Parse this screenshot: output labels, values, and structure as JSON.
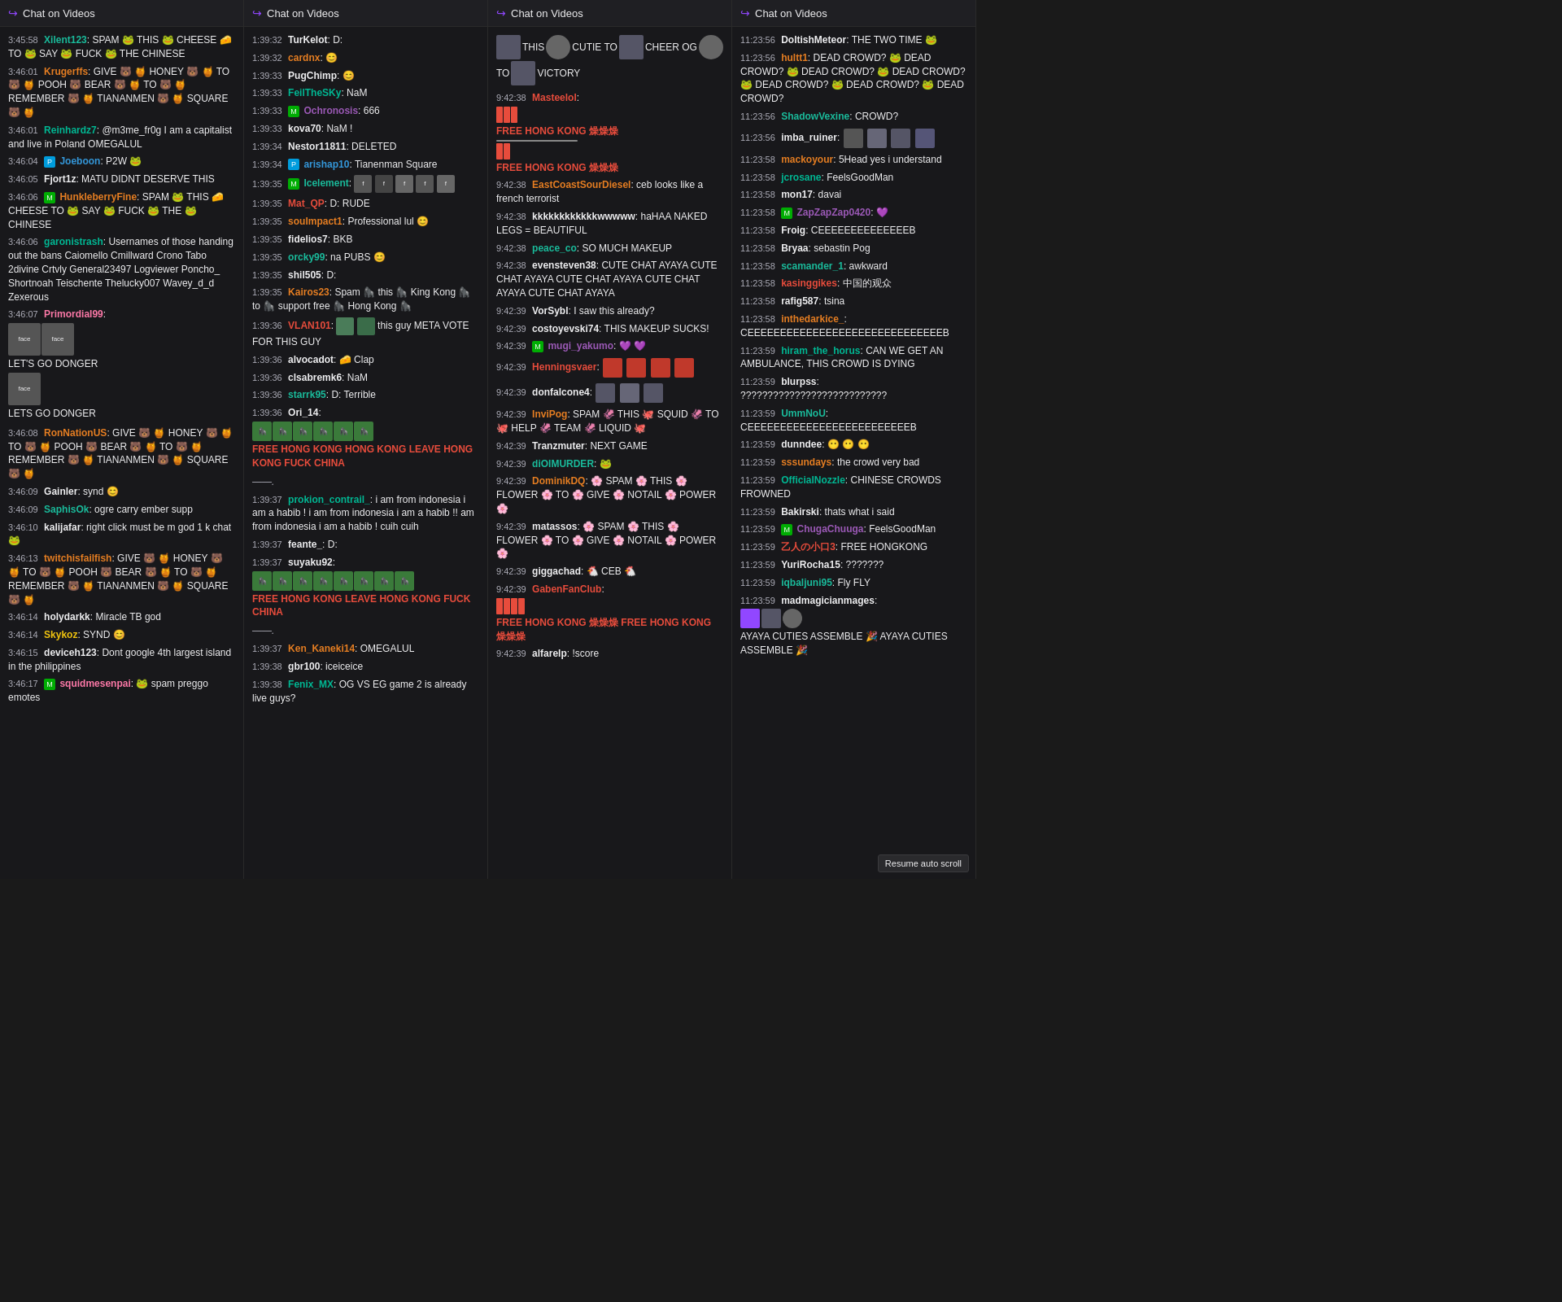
{
  "panels": [
    {
      "id": "panel1",
      "header": "Chat on Videos",
      "messages": [
        {
          "ts": "3:45:58",
          "user": "Xilent123",
          "userColor": "col-cyan",
          "text": "SPAM 🐸 THIS 🐸 CHEESE 🧀 TO 🐸 SAY 🐸 FUCK 🐸 THE CHINESE"
        },
        {
          "ts": "3:46:01",
          "user": "Krugerffs",
          "userColor": "col-orange",
          "text": "GIVE 🐻 🍯 HONEY 🐻 🍯 TO 🐻 🍯 POOH 🐻 BEAR 🐻 🍯 TO 🐻 🍯 REMEMBER 🐻 🍯 TIANANMEN 🐻 🍯 SQUARE 🐻 🍯"
        },
        {
          "ts": "3:46:01",
          "user": "Reinhardz7",
          "userColor": "col-green",
          "text": "@m3me_fr0g I am a capitalist and live in Poland OMEGALUL"
        },
        {
          "ts": "3:46:04",
          "user": "Joeboon",
          "userColor": "col-blue",
          "badge": "prime",
          "text": "P2W 🐸"
        },
        {
          "ts": "3:46:05",
          "user": "Fjort1z",
          "userColor": "col-white",
          "text": "MATU DIDNT DESERVE THIS"
        },
        {
          "ts": "3:46:06",
          "user": "HunkleberryFine",
          "userColor": "col-orange",
          "badge": "mod",
          "text": "SPAM 🐸 THIS 🧀 CHEESE TO 🐸 SAY 🐸 FUCK 🐸 THE 🐸 CHINESE"
        },
        {
          "ts": "3:46:06",
          "user": "garonistrash",
          "userColor": "col-green",
          "text": "Usernames of those handing out the bans Caiomello Cmillward Crono Tabo 2divine Crtvly General23497 Logviewer Poncho_ Shortnoah Teischente Thelucky007 Wavey_d_d Zexerous"
        },
        {
          "ts": "3:46:07",
          "user": "PrimordiaI99",
          "userColor": "col-pink",
          "text": "[emote block] LET'S GO DONGER LETS GO DONGER"
        },
        {
          "ts": "3:46:08",
          "user": "RonNationUS",
          "userColor": "col-orange",
          "text": "GIVE 🐻 🍯 HONEY 🐻 🍯 TO 🐻 🍯 POOH 🐻 BEAR 🐻 🍯 TO 🐻 🍯 REMEMBER 🐻 🍯 TIANANMEN 🐻 🍯 SQUARE 🐻 🍯"
        },
        {
          "ts": "3:46:09",
          "user": "Gainler",
          "userColor": "col-white",
          "text": "synd 😊"
        },
        {
          "ts": "3:46:09",
          "user": "SaphisOk",
          "userColor": "col-cyan",
          "text": "ogre carry ember supp"
        },
        {
          "ts": "3:46:10",
          "user": "kalijafar",
          "userColor": "col-white",
          "text": "right click must be m god 1 k chat 🐸"
        },
        {
          "ts": "3:46:13",
          "user": "twitchisfailfish",
          "userColor": "col-orange",
          "text": "GIVE 🐻 🍯 HONEY 🐻 🍯 TO 🐻 🍯 POOH 🐻 BEAR 🐻 🍯 TO 🐻 🍯 REMEMBER 🐻 🍯 TIANANMEN 🐻 🍯 SQUARE 🐻 🍯"
        },
        {
          "ts": "3:46:14",
          "user": "holydarkk",
          "userColor": "col-white",
          "text": "Miracle TB god"
        },
        {
          "ts": "3:46:14",
          "user": "Skykoz",
          "userColor": "col-yellow",
          "text": "SYND 😊"
        },
        {
          "ts": "3:46:15",
          "user": "deviceh123",
          "userColor": "col-white",
          "text": "Dont google 4th largest island in the philippines"
        },
        {
          "ts": "3:46:17",
          "user": "squidmesenpai",
          "userColor": "col-pink",
          "badge": "mod",
          "text": "🐸 spam preggo emotes"
        }
      ]
    },
    {
      "id": "panel2",
      "header": "Chat on Videos",
      "messages": [
        {
          "ts": "1:39:32",
          "user": "TurKelot",
          "userColor": "col-white",
          "text": "D:"
        },
        {
          "ts": "1:39:32",
          "user": "cardnx",
          "userColor": "col-orange",
          "text": "😊"
        },
        {
          "ts": "1:39:33",
          "user": "PugChimp",
          "userColor": "col-white",
          "text": "😊"
        },
        {
          "ts": "1:39:33",
          "user": "FeilTheSKy",
          "userColor": "col-green",
          "text": "NaM"
        },
        {
          "ts": "1:39:33",
          "user": "Ochronosis",
          "userColor": "col-purple",
          "badge": "mod",
          "text": "666"
        },
        {
          "ts": "1:39:33",
          "user": "kova70",
          "userColor": "col-white",
          "text": "NaM !"
        },
        {
          "ts": "1:39:34",
          "user": "Nestor11811",
          "userColor": "col-white",
          "text": "DELETED"
        },
        {
          "ts": "1:39:34",
          "user": "arishap10",
          "userColor": "col-blue",
          "badge": "prime",
          "text": "Tianenman Square"
        },
        {
          "ts": "1:39:35",
          "user": "Icelement",
          "userColor": "col-cyan",
          "badge": "mod",
          "text": "[face emotes row]"
        },
        {
          "ts": "1:39:35",
          "user": "Mat_QP",
          "userColor": "col-red",
          "text": "D: RUDE"
        },
        {
          "ts": "1:39:35",
          "user": "soulmpact1",
          "userColor": "col-orange",
          "text": "Professional lul 😊"
        },
        {
          "ts": "1:39:35",
          "user": "fidelios7",
          "userColor": "col-white",
          "text": "BKB"
        },
        {
          "ts": "1:39:35",
          "user": "orcky99",
          "userColor": "col-cyan",
          "text": "na PUBS 😊"
        },
        {
          "ts": "1:39:35",
          "user": "shil505",
          "userColor": "col-white",
          "text": "D:"
        },
        {
          "ts": "1:39:35",
          "user": "Kairos23",
          "userColor": "col-orange",
          "text": "Spam 🦍 this 🦍 King Kong 🦍 to 🦍 support free 🦍 Hong Kong 🦍"
        },
        {
          "ts": "1:39:36",
          "user": "VLAN101",
          "userColor": "col-red",
          "text": "[emotes] this guy META VOTE FOR THIS GUY"
        },
        {
          "ts": "1:39:36",
          "user": "alvocadot",
          "userColor": "col-white",
          "text": "🧀 Clap"
        },
        {
          "ts": "1:39:36",
          "user": "clsabremk6",
          "userColor": "col-white",
          "text": "NaM"
        },
        {
          "ts": "1:39:36",
          "user": "starrk95",
          "userColor": "col-cyan",
          "text": "D: Terrible"
        },
        {
          "ts": "1:39:36",
          "user": "Ori_14",
          "userColor": "col-white",
          "text": "[emote grid] FREE HONG KONG HONG KONG LEAVE HONG KONG FUCK CHINA"
        },
        {
          "ts": "",
          "user": "",
          "userColor": "",
          "text": ""
        },
        {
          "ts": "1:39:37",
          "user": "prokion_contrail_",
          "userColor": "col-green",
          "text": "i am from indonesia i am a habib ! i am from indonesia i am a habib !! am from indonesia i am a habib ! cuih cuih"
        },
        {
          "ts": "1:39:37",
          "user": "feante_",
          "userColor": "col-white",
          "text": "D:"
        },
        {
          "ts": "1:39:37",
          "user": "suyaku92",
          "userColor": "col-white",
          "text": "[emotes] FREE HONG KONG LEAVE HONG KONG FUCK CHINA"
        },
        {
          "ts": "",
          "user": "",
          "userColor": "",
          "text": ""
        },
        {
          "ts": "1:39:37",
          "user": "Ken_Kaneki14",
          "userColor": "col-orange",
          "text": "OMEGALUL"
        },
        {
          "ts": "1:39:38",
          "user": "gbr100",
          "userColor": "col-white",
          "text": "iceiceice"
        },
        {
          "ts": "1:39:38",
          "user": "Fenix_MX",
          "userColor": "col-green",
          "text": "OG VS EG game 2 is already live guys?"
        }
      ]
    },
    {
      "id": "panel3",
      "header": "Chat on Videos",
      "messages": [
        {
          "ts": "",
          "user": "",
          "userColor": "",
          "text": "THIS 🐱 CUTIE TO 🐱 CHEER OG 🐱 TO 🐱 VICTORY"
        },
        {
          "ts": "9:42:38",
          "user": "Masteelol",
          "userColor": "col-red",
          "text": "[bar emotes] FREE HONG KONG 燥燥燥 [bars] FREE HONG KONG 燥燥燥"
        },
        {
          "ts": "9:42:38",
          "user": "EastCoastSourDiesel",
          "userColor": "col-orange",
          "text": "ceb looks like a french terrorist"
        },
        {
          "ts": "9:42:38",
          "user": "kkkkkkkkkkkkwwwww",
          "userColor": "col-white",
          "text": "haHAA NAKED LEGS = BEAUTIFUL"
        },
        {
          "ts": "9:42:38",
          "user": "peace_co",
          "userColor": "col-cyan",
          "text": "SO MUCH MAKEUP"
        },
        {
          "ts": "9:42:38",
          "user": "evensteven38",
          "userColor": "col-white",
          "text": "CUTE CHAT AYAYA CUTE CHAT AYAYA CUTE CHAT AYAYA CUTE CHAT AYAYA CUTE CHAT AYAYA"
        },
        {
          "ts": "9:42:39",
          "user": "VorSybl",
          "userColor": "col-white",
          "text": "I saw this already?"
        },
        {
          "ts": "9:42:39",
          "user": "costoyevski74",
          "userColor": "col-white",
          "text": "THIS MAKEUP SUCKS!"
        },
        {
          "ts": "9:42:39",
          "user": "mugi_yakumo",
          "userColor": "col-purple",
          "badge": "mod",
          "text": "💜 💜"
        },
        {
          "ts": "9:42:39",
          "user": "Henningsvaer",
          "userColor": "col-red",
          "text": "[red emotes row]"
        },
        {
          "ts": "9:42:39",
          "user": "donfalcone4",
          "userColor": "col-white",
          "text": "[face emotes]"
        },
        {
          "ts": "9:42:39",
          "user": "InviPog",
          "userColor": "col-orange",
          "text": "SPAM 🦑 THIS 🐙 SQUID 🦑 TO 🐙 HELP 🦑 TEAM 🦑 LIQUID 🐙"
        },
        {
          "ts": "9:42:39",
          "user": "Tranzmuter",
          "userColor": "col-white",
          "text": "NEXT GAME"
        },
        {
          "ts": "9:42:39",
          "user": "diOIMURDER",
          "userColor": "col-cyan",
          "text": "🐸"
        },
        {
          "ts": "9:42:39",
          "user": "DominikDQ",
          "userColor": "col-orange",
          "text": "🌸 SPAM 🌸 THIS 🌸 FLOWER 🌸 TO 🌸 GIVE 🌸 NOTAIL 🌸 POWER 🌸"
        },
        {
          "ts": "9:42:39",
          "user": "matassos",
          "userColor": "col-white",
          "text": "🌸 SPAM 🌸 THIS 🌸 FLOWER 🌸 TO 🌸 GIVE 🌸 NOTAIL 🌸 POWER 🌸"
        },
        {
          "ts": "9:42:39",
          "user": "giggachad",
          "userColor": "col-white",
          "text": "🐔 CEB 🐔"
        },
        {
          "ts": "9:42:39",
          "user": "GabenFanClub",
          "userColor": "col-red",
          "text": "[emote grid] FREE HONG KONG 燥燥燥 FREE HONG KONG 燥燥燥"
        }
      ]
    },
    {
      "id": "panel4",
      "header": "Chat on Videos",
      "messages": [
        {
          "ts": "11:23:56",
          "user": "DoltishMeteor",
          "userColor": "col-white",
          "text": "THE TWO TIME 🐸"
        },
        {
          "ts": "11:23:56",
          "user": "hultt1",
          "userColor": "col-orange",
          "text": "DEAD CROWD? 🐸 DEAD CROWD? 🐸 DEAD CROWD? 🐸 DEAD CROWD? 🐸 DEAD CROWD? 🐸 DEAD CROWD? 🐸 DEAD CROWD?"
        },
        {
          "ts": "11:23:56",
          "user": "ShadowVexine",
          "userColor": "col-cyan",
          "text": "CROWD?"
        },
        {
          "ts": "11:23:56",
          "user": "imba_ruiner",
          "userColor": "col-white",
          "text": "[face emotes row]"
        },
        {
          "ts": "11:23:58",
          "user": "mackoyour",
          "userColor": "col-orange",
          "text": "5Head yes i understand"
        },
        {
          "ts": "11:23:58",
          "user": "jcrosane",
          "userColor": "col-green",
          "text": "FeelsGoodMan"
        },
        {
          "ts": "11:23:58",
          "user": "mon17",
          "userColor": "col-white",
          "text": "davai"
        },
        {
          "ts": "11:23:58",
          "user": "ZapZapZap0420",
          "userColor": "col-purple",
          "badge": "mod",
          "text": "💜"
        },
        {
          "ts": "11:23:58",
          "user": "Froig",
          "userColor": "col-white",
          "text": "CEEEEEEEEEEEEEEB"
        },
        {
          "ts": "11:23:58",
          "user": "Bryaa",
          "userColor": "col-white",
          "text": "sebastin Pog"
        },
        {
          "ts": "11:23:58",
          "user": "scamander_1",
          "userColor": "col-cyan",
          "text": "awkward"
        },
        {
          "ts": "11:23:58",
          "user": "kasinggikes",
          "userColor": "col-red",
          "text": "中国的观众"
        },
        {
          "ts": "11:23:58",
          "user": "rafig587",
          "userColor": "col-white",
          "text": "tsina"
        },
        {
          "ts": "11:23:58",
          "user": "inthedarkice_",
          "userColor": "col-orange",
          "text": "CEEEEEEEEEEEEEEEEEEEEEEEEEEEEEEB"
        },
        {
          "ts": "11:23:59",
          "user": "hiram_the_horus",
          "userColor": "col-green",
          "text": "CAN WE GET AN AMBULANCE, THIS CROWD IS DYING"
        },
        {
          "ts": "11:23:59",
          "user": "blurpss",
          "userColor": "col-white",
          "text": "???????????????????????????"
        },
        {
          "ts": "11:23:59",
          "user": "UmmNoU",
          "userColor": "col-cyan",
          "text": "CEEEEEEEEEEEEEEEEEEEEEEEEEB"
        },
        {
          "ts": "11:23:59",
          "user": "dunndee",
          "userColor": "col-white",
          "text": "😶 😶 😶"
        },
        {
          "ts": "11:23:59",
          "user": "sssundays",
          "userColor": "col-orange",
          "text": "the crowd very bad"
        },
        {
          "ts": "11:23:59",
          "user": "OfficialNozzle",
          "userColor": "col-green",
          "text": "CHINESE CROWDS FROWNED"
        },
        {
          "ts": "11:23:59",
          "user": "Bakirski",
          "userColor": "col-white",
          "text": "thats what i said"
        },
        {
          "ts": "11:23:59",
          "user": "ChugaChuuga",
          "userColor": "col-purple",
          "badge": "mod",
          "text": "FeelsGoodMan"
        },
        {
          "ts": "11:23:59",
          "user": "乙人の小口3",
          "userColor": "col-red",
          "text": "FREE HONGKONG"
        },
        {
          "ts": "11:23:59",
          "user": "YuriRocha15",
          "userColor": "col-white",
          "text": "???????"
        },
        {
          "ts": "11:23:59",
          "user": "iqbaljuni95",
          "userColor": "col-cyan",
          "text": "Fly FLY"
        },
        {
          "ts": "11:23:59",
          "user": "madmagicianmages",
          "userColor": "col-white",
          "text": "[emote block] AYAYA CUTIES ASSEMBLE 🎉 AYAYA CUTIES ASSEMBLE 🎉"
        }
      ],
      "autoScrollBtn": "Resume auto scroll"
    }
  ]
}
